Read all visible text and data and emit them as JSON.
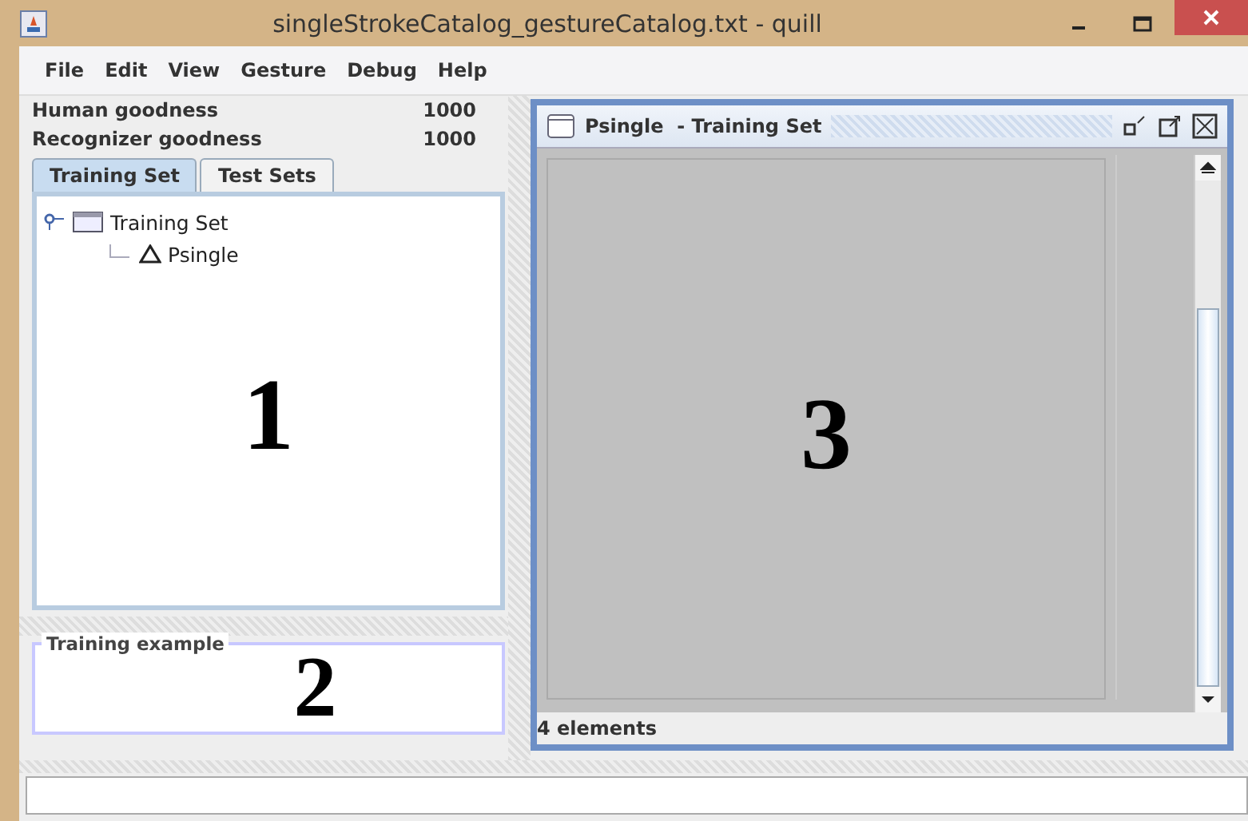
{
  "window": {
    "title": "singleStrokeCatalog_gestureCatalog.txt - quill"
  },
  "menu": [
    "File",
    "Edit",
    "View",
    "Gesture",
    "Debug",
    "Help"
  ],
  "goodness": [
    {
      "label": "Human goodness",
      "value": "1000"
    },
    {
      "label": "Recognizer goodness",
      "value": "1000"
    }
  ],
  "tabs": [
    {
      "label": "Training Set",
      "selected": true
    },
    {
      "label": "Test Sets",
      "selected": false
    }
  ],
  "tree": [
    {
      "label": "Training Set",
      "kind": "set",
      "expanded": true,
      "children": [
        {
          "label": "Psingle",
          "kind": "gesture"
        }
      ]
    }
  ],
  "tree_panel": {
    "annotation": "1"
  },
  "training_example": {
    "title": "Training example",
    "annotation": "2"
  },
  "frame": {
    "title": "Psingle  - Training Set",
    "annotation": "3",
    "status": "4 elements"
  }
}
